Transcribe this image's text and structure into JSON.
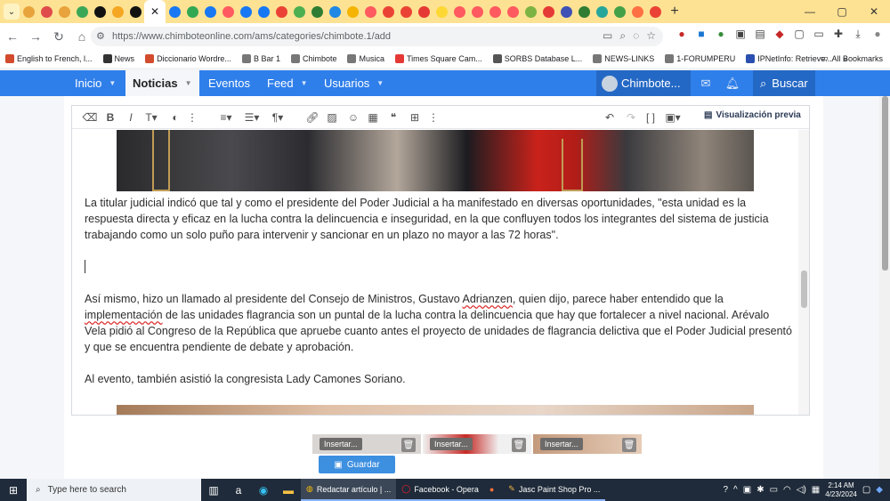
{
  "browser": {
    "tab_colors": [
      "#e8a33c",
      "#e04b4b",
      "#e8a33c",
      "#3aa757",
      "#111111",
      "#f5a623",
      "#111111",
      "#1877f2",
      "#33a853",
      "#1877f2",
      "#ff5a5f",
      "#1877f2",
      "#1877f2",
      "#ea4335",
      "#4caf50",
      "#2e7d32",
      "#1e88e5",
      "#f4b400",
      "#ff5a5f",
      "#ea4335",
      "#ea4335",
      "#e53935",
      "#fdd835",
      "#ff5a5f",
      "#ff5a5f",
      "#ff5a5f",
      "#ff5a5f",
      "#7cb342",
      "#e53935",
      "#3f51b5",
      "#2e7d32",
      "#26a69a",
      "#43a047",
      "#ff7043",
      "#ea4335"
    ],
    "new_tab": "+",
    "url": "https://www.chimboteonline.com/ams/categories/chimbote.1/add"
  },
  "bookmarks": [
    {
      "label": "English to French, l...",
      "color": "#d24b2d"
    },
    {
      "label": "News",
      "color": "#333333"
    },
    {
      "label": "Diccionario Wordre...",
      "color": "#d24b2d"
    },
    {
      "label": "B Bar 1",
      "color": "#777777"
    },
    {
      "label": "Chimbote",
      "color": "#777777"
    },
    {
      "label": "Musica",
      "color": "#777777"
    },
    {
      "label": "Times Square Cam...",
      "color": "#e53935"
    },
    {
      "label": "SORBS Database L...",
      "color": "#555555"
    },
    {
      "label": "NEWS-LINKS",
      "color": "#777777"
    },
    {
      "label": "1-FORUMPERU",
      "color": "#777777"
    },
    {
      "label": "IPNetInfo: Retrieve...",
      "color": "#2a4fb0"
    }
  ],
  "bookmarks_more": "»",
  "all_bookmarks": "All Bookmarks",
  "nav": {
    "inicio": "Inicio",
    "noticias": "Noticias",
    "eventos": "Eventos",
    "feed": "Feed",
    "usuarios": "Usuarios",
    "user": "Chimbote...",
    "search": "Buscar"
  },
  "toolbar": {
    "preview": "Visualización previa"
  },
  "article": {
    "p1": "La titular judicial indicó que tal y como el presidente del Poder Judicial a ha manifestado en diversas oportunidades, \"esta unidad es la respuesta directa y eficaz en la lucha contra la delincuencia e inseguridad, en la que confluyen todos los integrantes del sistema de justicia trabajando como un solo puño para intervenir y sancionar en un plazo no mayor a las 72 horas\".",
    "p2_a": "Así mismo, hizo un llamado  al presidente del Consejo de Ministros, Gustavo ",
    "p2_b": "Adrianzen",
    "p2_c": ", quien dijo, parece haber entendido que la ",
    "p2_d": "implementación",
    "p2_e": " de las unidades flagrancia son un puntal de la lucha contra la delincuencia  que hay que fortalecer  a nivel nacional. Arévalo Vela pidió al Congreso de la República que apruebe  cuanto antes el proyecto  de unidades de flagrancia delictiva que  el Poder Judicial presentó y que se encuentra pendiente de debate y aprobación.",
    "p3": "Al evento, también asistió la congresista Lady Camones Soriano."
  },
  "attachments": [
    {
      "insert": "Insertar..."
    },
    {
      "insert": "Insertar..."
    },
    {
      "insert": "Insertar..."
    }
  ],
  "save": "Guardar",
  "taskbar": {
    "search": "Type here to search",
    "tasks": [
      {
        "label": "Redactar artículo | ...",
        "active": true
      },
      {
        "label": "Facebook - Opera",
        "active": false
      },
      {
        "label": "",
        "active": false
      },
      {
        "label": "Jasc Paint Shop Pro ...",
        "active": false
      }
    ],
    "time": "2:14 AM",
    "date": "4/23/2024"
  }
}
